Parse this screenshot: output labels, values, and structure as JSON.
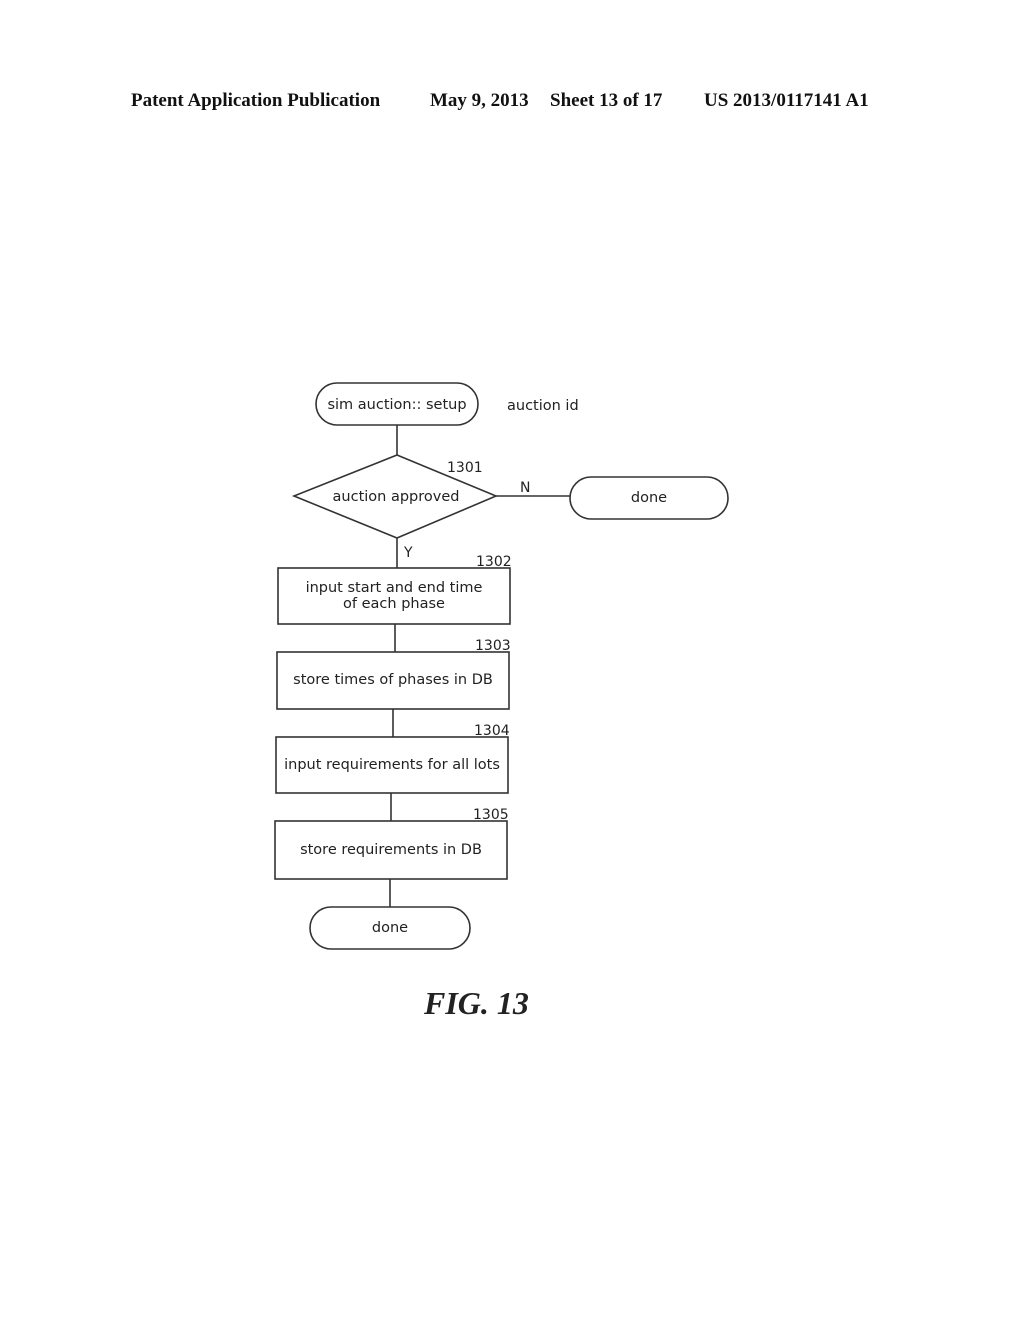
{
  "header": {
    "title": "Patent Application Publication",
    "date": "May 9, 2013",
    "sheet": "Sheet 13 of 17",
    "pub_number": "US 2013/0117141 A1"
  },
  "flowchart": {
    "start": {
      "label": "sim auction:: setup",
      "annotation": "auction id"
    },
    "decision": {
      "ref": "1301",
      "label": "auction approved",
      "no_label": "N",
      "yes_label": "Y",
      "no_target": "done"
    },
    "steps": [
      {
        "ref": "1302",
        "lines": [
          "input start and end time",
          "of each phase"
        ]
      },
      {
        "ref": "1303",
        "lines": [
          "store times of phases in DB"
        ]
      },
      {
        "ref": "1304",
        "lines": [
          "input requirements for all lots"
        ]
      },
      {
        "ref": "1305",
        "lines": [
          "store requirements in DB"
        ]
      }
    ],
    "end": {
      "label": "done"
    }
  },
  "figure_label": "FIG. 13"
}
